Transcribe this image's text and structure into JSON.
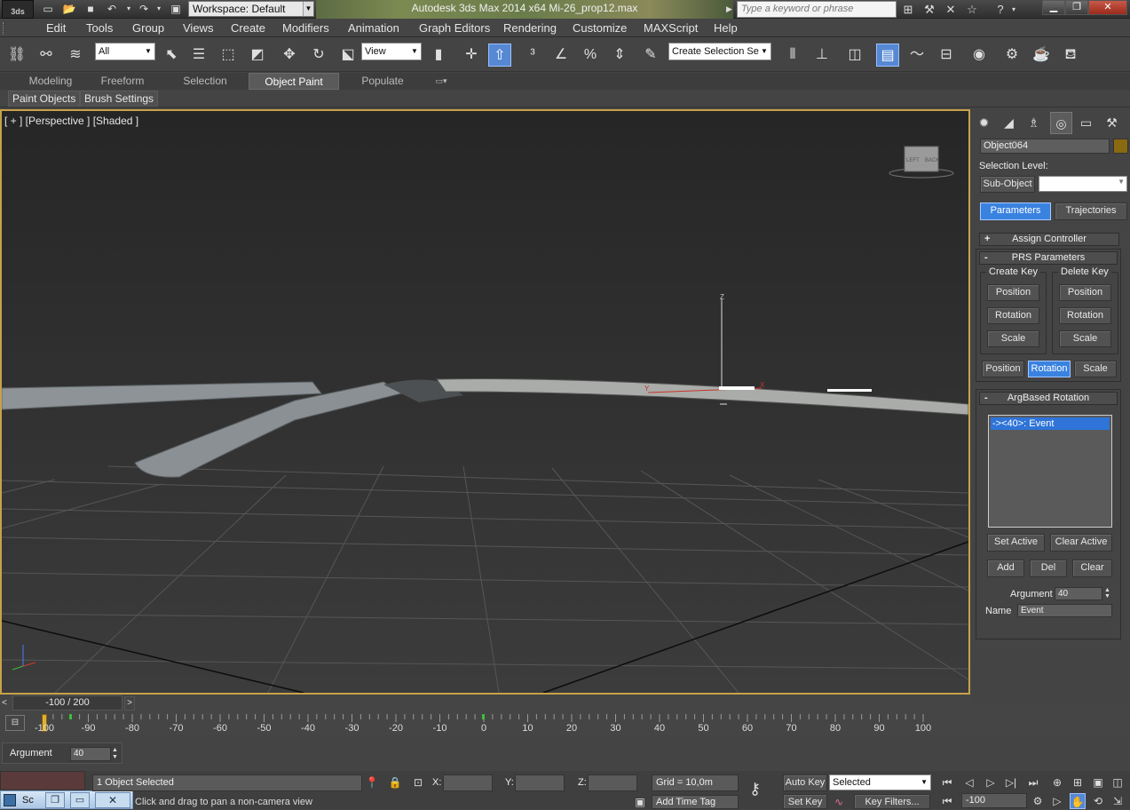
{
  "titlebar": {
    "app_icon": "3ds",
    "workspace": "Workspace: Default",
    "title": "Autodesk 3ds Max  2014 x64      Mi-26_prop12.max",
    "search_placeholder": "Type a keyword or phrase",
    "icons": [
      "new-icon",
      "open-icon",
      "save-icon",
      "undo-icon",
      "redo-icon",
      "project-icon",
      "binoculars-icon",
      "hammer-icon",
      "tools-icon",
      "star-icon",
      "help-icon"
    ],
    "window_buttons": [
      "minimize",
      "restore",
      "close"
    ]
  },
  "menu": {
    "items": [
      "Edit",
      "Tools",
      "Group",
      "Views",
      "Create",
      "Modifiers",
      "Animation",
      "Graph Editors",
      "Rendering",
      "Customize",
      "MAXScript",
      "Help"
    ]
  },
  "toolbar": {
    "filter_value": "All",
    "ref_coord_value": "View",
    "selection_set_placeholder": "Create Selection Se"
  },
  "ribbon": {
    "tabs": [
      "Modeling",
      "Freeform",
      "Selection",
      "Object Paint",
      "Populate"
    ],
    "active_tab": "Object Paint",
    "buttons": [
      "Paint Objects",
      "Brush Settings"
    ]
  },
  "viewport": {
    "label": "[ + ] [Perspective ] [Shaded ]",
    "viewcube_labels": [
      "LEFT",
      "BACK"
    ],
    "gizmo_axes": [
      "Z",
      "Y",
      "X"
    ]
  },
  "command_panel": {
    "object_name": "Object064",
    "object_color": "#8a6a10",
    "selection_level_label": "Selection Level:",
    "sub_object_label": "Sub-Object",
    "mode_buttons": [
      "Parameters",
      "Trajectories"
    ],
    "active_mode": "Parameters",
    "assign_controller": {
      "sign": "+",
      "title": "Assign Controller"
    },
    "prs": {
      "sign": "-",
      "title": "PRS Parameters",
      "create_key_label": "Create Key",
      "delete_key_label": "Delete Key",
      "key_buttons": [
        "Position",
        "Rotation",
        "Scale"
      ],
      "bottom_buttons": [
        "Position",
        "Rotation",
        "Scale"
      ],
      "active_bottom": "Rotation"
    },
    "argbased": {
      "sign": "-",
      "title": "ArgBased Rotation",
      "list_items": [
        "-><40>: Event"
      ],
      "buttons_row1": [
        "Set Active",
        "Clear Active"
      ],
      "buttons_row2": [
        "Add",
        "Del",
        "Clear"
      ],
      "argument_label": "Argument",
      "argument_value": "40",
      "name_label": "Name",
      "name_value": "Event"
    }
  },
  "timeline": {
    "slider_label": "-100 / 200",
    "prev": "<",
    "next": ">",
    "ticks": [
      "-100",
      "-90",
      "-80",
      "-70",
      "-60",
      "-50",
      "-40",
      "-30",
      "-20",
      "-10",
      "0",
      "10",
      "20",
      "30",
      "40",
      "50",
      "60",
      "70",
      "80",
      "90",
      "100"
    ]
  },
  "argument_box": {
    "label": "Argument",
    "value": "40"
  },
  "status": {
    "script_label": "Sc",
    "selected_text": "1 Object Selected",
    "prompt_text": "Click and drag to pan a non-camera view",
    "x_label": "X:",
    "y_label": "Y:",
    "z_label": "Z:",
    "grid": "Grid = 10,0m",
    "add_time_tag": "Add Time Tag",
    "auto_key": "Auto Key",
    "set_key": "Set Key",
    "selected_dropdown": "Selected",
    "key_filters": "Key Filters...",
    "frame_value": "-100"
  },
  "colors": {
    "viewport_border": "#c8a24a",
    "active_blue": "#3a82e0"
  }
}
